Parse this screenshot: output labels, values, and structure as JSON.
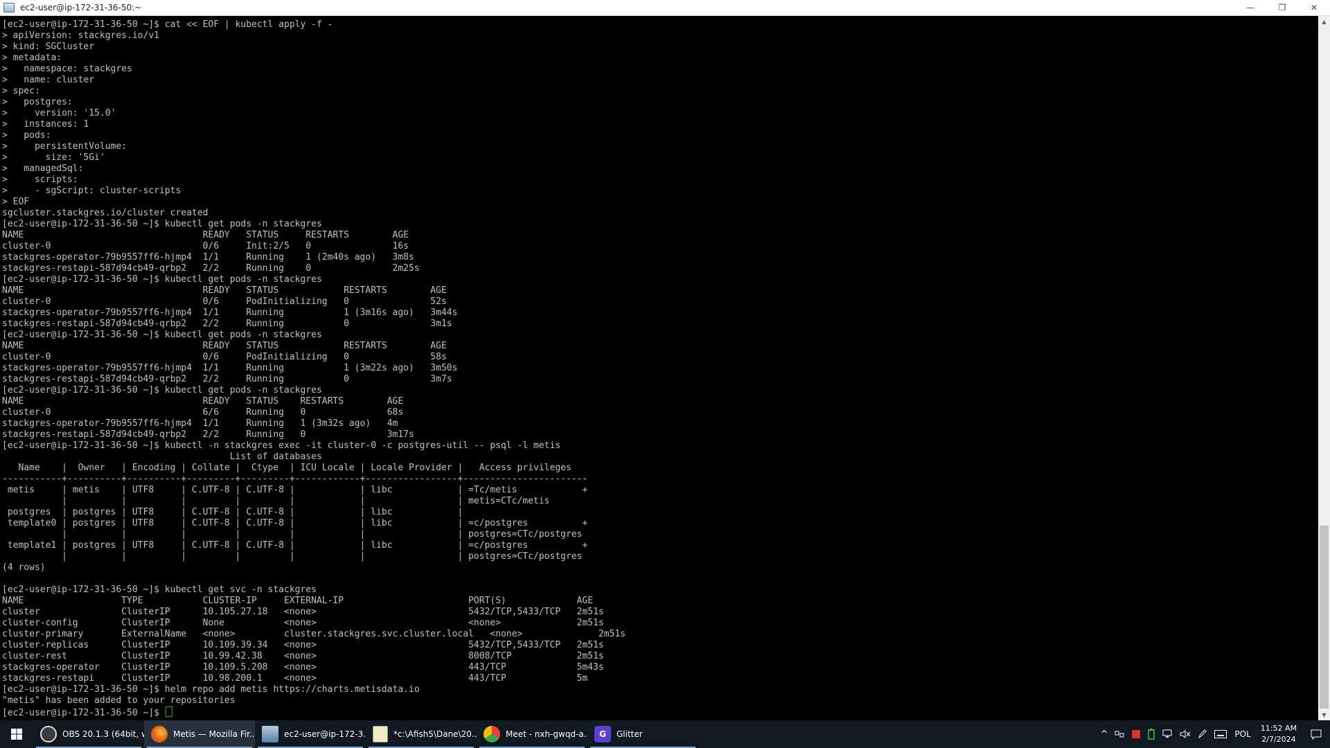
{
  "window": {
    "title": "ec2-user@ip-172-31-36-50:~",
    "controls": {
      "minimize": "—",
      "restore": "❐",
      "close": "✕"
    }
  },
  "terminal": {
    "lines": [
      "[ec2-user@ip-172-31-36-50 ~]$ cat << EOF | kubectl apply -f -",
      "> apiVersion: stackgres.io/v1",
      "> kind: SGCluster",
      "> metadata:",
      ">   namespace: stackgres",
      ">   name: cluster",
      "> spec:",
      ">   postgres:",
      ">     version: '15.0'",
      ">   instances: 1",
      ">   pods:",
      ">     persistentVolume:",
      ">       size: '5Gi'",
      ">   managedSql:",
      ">     scripts:",
      ">     - sgScript: cluster-scripts",
      "> EOF",
      "sgcluster.stackgres.io/cluster created",
      "[ec2-user@ip-172-31-36-50 ~]$ kubectl get pods -n stackgres",
      "NAME                                 READY   STATUS     RESTARTS        AGE",
      "cluster-0                            0/6     Init:2/5   0               16s",
      "stackgres-operator-79b9557ff6-hjmp4  1/1     Running    1 (2m40s ago)   3m8s",
      "stackgres-restapi-587d94cb49-qrbp2   2/2     Running    0               2m25s",
      "[ec2-user@ip-172-31-36-50 ~]$ kubectl get pods -n stackgres",
      "NAME                                 READY   STATUS            RESTARTS        AGE",
      "cluster-0                            0/6     PodInitializing   0               52s",
      "stackgres-operator-79b9557ff6-hjmp4  1/1     Running           1 (3m16s ago)   3m44s",
      "stackgres-restapi-587d94cb49-qrbp2   2/2     Running           0               3m1s",
      "[ec2-user@ip-172-31-36-50 ~]$ kubectl get pods -n stackgres",
      "NAME                                 READY   STATUS            RESTARTS        AGE",
      "cluster-0                            0/6     PodInitializing   0               58s",
      "stackgres-operator-79b9557ff6-hjmp4  1/1     Running           1 (3m22s ago)   3m50s",
      "stackgres-restapi-587d94cb49-qrbp2   2/2     Running           0               3m7s",
      "[ec2-user@ip-172-31-36-50 ~]$ kubectl get pods -n stackgres",
      "NAME                                 READY   STATUS    RESTARTS        AGE",
      "cluster-0                            6/6     Running   0               68s",
      "stackgres-operator-79b9557ff6-hjmp4  1/1     Running   1 (3m32s ago)   4m",
      "stackgres-restapi-587d94cb49-qrbp2   2/2     Running   0               3m17s",
      "[ec2-user@ip-172-31-36-50 ~]$ kubectl -n stackgres exec -it cluster-0 -c postgres-util -- psql -l metis",
      "                                          List of databases",
      "   Name    |  Owner   | Encoding | Collate |  Ctype  | ICU Locale | Locale Provider |   Access privileges",
      "-----------+----------+----------+---------+---------+------------+-----------------+-----------------------",
      " metis     | metis    | UTF8     | C.UTF-8 | C.UTF-8 |            | libc            | =Tc/metis            +",
      "           |          |          |         |         |            |                 | metis=CTc/metis",
      " postgres  | postgres | UTF8     | C.UTF-8 | C.UTF-8 |            | libc            |",
      " template0 | postgres | UTF8     | C.UTF-8 | C.UTF-8 |            | libc            | =c/postgres          +",
      "           |          |          |         |         |            |                 | postgres=CTc/postgres",
      " template1 | postgres | UTF8     | C.UTF-8 | C.UTF-8 |            | libc            | =c/postgres          +",
      "           |          |          |         |         |            |                 | postgres=CTc/postgres",
      "(4 rows)",
      "",
      "[ec2-user@ip-172-31-36-50 ~]$ kubectl get svc -n stackgres",
      "NAME                  TYPE           CLUSTER-IP     EXTERNAL-IP                       PORT(S)             AGE",
      "cluster               ClusterIP      10.105.27.18   <none>                            5432/TCP,5433/TCP   2m51s",
      "cluster-config        ClusterIP      None           <none>                            <none>              2m51s",
      "cluster-primary       ExternalName   <none>         cluster.stackgres.svc.cluster.local   <none>              2m51s",
      "cluster-replicas      ClusterIP      10.109.39.34   <none>                            5432/TCP,5433/TCP   2m51s",
      "cluster-rest          ClusterIP      10.99.42.38    <none>                            8008/TCP            2m51s",
      "stackgres-operator    ClusterIP      10.109.5.208   <none>                            443/TCP             5m43s",
      "stackgres-restapi     ClusterIP      10.98.200.1    <none>                            443/TCP             5m",
      "[ec2-user@ip-172-31-36-50 ~]$ helm repo add metis https://charts.metisdata.io",
      "\"metis\" has been added to your repositories"
    ],
    "prompt": "[ec2-user@ip-172-31-36-50 ~]$ "
  },
  "scrollbar": {
    "up_arrow": "▲",
    "down_arrow": "▼",
    "position_fraction": 0.97
  },
  "taskbar": {
    "start_icon": "windows-logo",
    "items": [
      {
        "label": "OBS 20.1.3 (64bit, w...",
        "icon": "obs-icon",
        "color": "#3c3c3c"
      },
      {
        "label": "Metis — Mozilla Fir...",
        "icon": "firefox-icon",
        "color": "#e66000"
      },
      {
        "label": "ec2-user@ip-172-3...",
        "icon": "putty-icon",
        "color": "#5a7fa8"
      },
      {
        "label": "*c:\\Afish5\\Dane\\20...",
        "icon": "notepad-icon",
        "color": "#f3e9c6"
      },
      {
        "label": "Meet - nxh-gwqd-a...",
        "icon": "chrome-icon",
        "color": "#34a853"
      },
      {
        "label": "Glitter",
        "icon": "glitter-icon",
        "color": "#5b3fd1"
      }
    ],
    "tray": {
      "chevron": "^",
      "language": "POL",
      "time": "11:52 AM",
      "date": "2/7/2024"
    }
  },
  "colors": {
    "terminal_bg": "#000000",
    "terminal_fg": "#c0c0c0",
    "cursor": "#00c000",
    "taskbar_bg": "#101820",
    "active_underline": "#7aa7d8"
  }
}
